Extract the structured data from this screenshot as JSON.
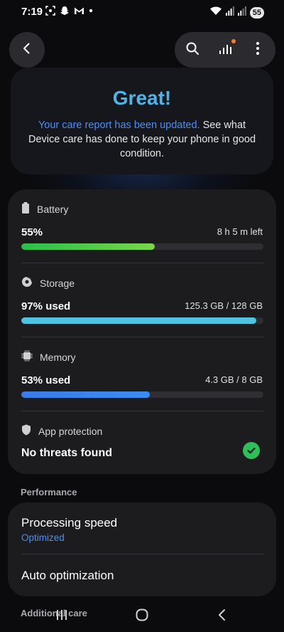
{
  "status_bar": {
    "time": "7:19",
    "battery_level": "55",
    "notification_icons": [
      "screenshot-icon",
      "snapchat-icon",
      "gmail-icon",
      "dot-icon"
    ],
    "system_icons": [
      "wifi-icon",
      "signal-icon",
      "signal-icon"
    ]
  },
  "top_bar": {
    "back_icon": "chevron-left-icon",
    "search_icon": "search-icon",
    "report_icon": "bar-chart-icon",
    "more_icon": "more-vertical-icon",
    "report_badge_color": "#ff7a2a"
  },
  "hero": {
    "title": "Great!",
    "message_link": "Your care report has been updated.",
    "message_rest": " See what Device care has done to keep your phone in good condition."
  },
  "status": {
    "battery": {
      "label": "Battery",
      "value": "55%",
      "detail": "8 h 5 m left",
      "level": 0.55,
      "color_start": "#2bbf4a",
      "color_end": "#79d64a"
    },
    "storage": {
      "label": "Storage",
      "value": "97% used",
      "detail": "125.3 GB / 128 GB",
      "level": 0.97,
      "color": "#4fc3e0"
    },
    "memory": {
      "label": "Memory",
      "value": "53% used",
      "detail": "4.3 GB / 8 GB",
      "level": 0.53,
      "color_start": "#3a7be8",
      "color_end": "#3b8cf2"
    },
    "app_protection": {
      "label": "App protection",
      "value": "No threats found",
      "status_color": "#2fbf5a"
    }
  },
  "performance": {
    "section_label": "Performance",
    "processing_speed": {
      "title": "Processing speed",
      "value": "Optimized"
    },
    "auto_optimization": {
      "title": "Auto optimization"
    }
  },
  "additional": {
    "section_label": "Additional care"
  },
  "nav": {
    "recents_icon": "recents-icon",
    "home_icon": "home-icon",
    "back_icon": "back-icon"
  }
}
